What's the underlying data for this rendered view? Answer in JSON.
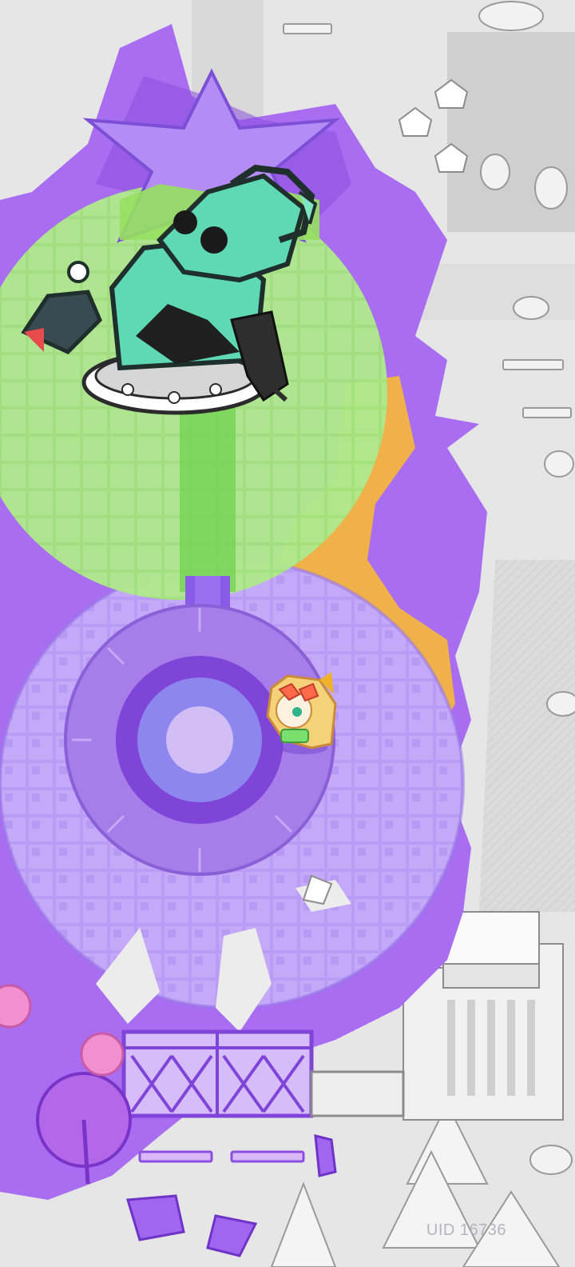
{
  "hud": {
    "uid_text": "UID 16736"
  },
  "colors": {
    "ground": "#e6e6e6",
    "ink_purple": "#a86df0",
    "ink_purple_dark": "#8a4fe0",
    "ink_orange": "#f0b04a",
    "zone_green": "#7ed957",
    "zone_green_light": "#b8ea92",
    "tile_purple": "#b99cf5",
    "platform_inner": "#b9a8f7",
    "platform_core": "#d8c8fb",
    "boss_teal": "#5fd9b4",
    "player_hair": "#f5d27a",
    "player_goggles": "#ff6b4a"
  },
  "sprites": {
    "boss": "statue-of-liberty-mech-icon",
    "player": "blonde-chibi-girl-icon",
    "boss_weapon": "minigun-icon",
    "boss_missile": "missile-icon"
  }
}
